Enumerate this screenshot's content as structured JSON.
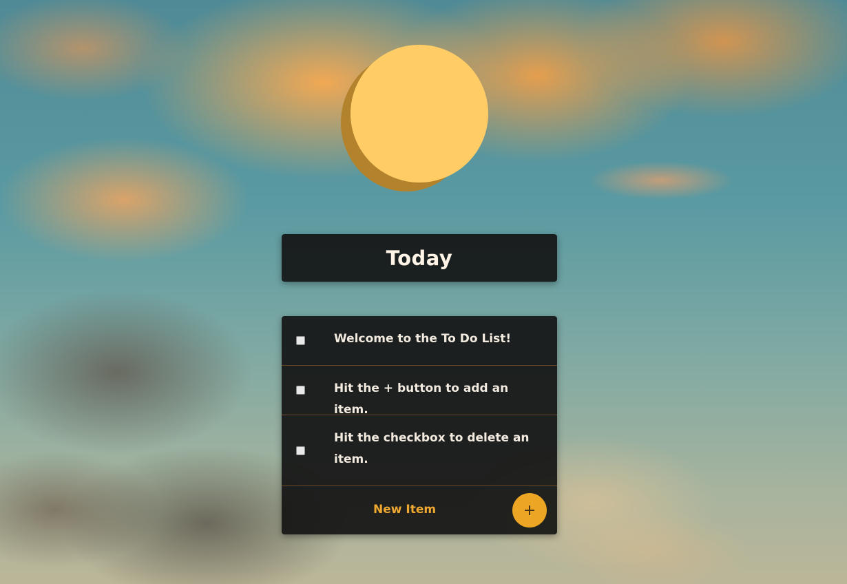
{
  "header": {
    "title": "Today"
  },
  "todo": {
    "items": [
      {
        "label": "Welcome to the To Do List!",
        "checked": false
      },
      {
        "label": "Hit the + button to add an item.",
        "checked": false
      },
      {
        "label": "Hit the checkbox to delete an item.",
        "checked": false
      }
    ],
    "new_item_placeholder": "New Item",
    "add_button_icon": "plus-icon"
  },
  "colors": {
    "sun": "#ffcc66",
    "sun_shadow": "#b2822c",
    "card_background": "#141414",
    "accent": "#eca623",
    "divider": "#6b4a25"
  }
}
